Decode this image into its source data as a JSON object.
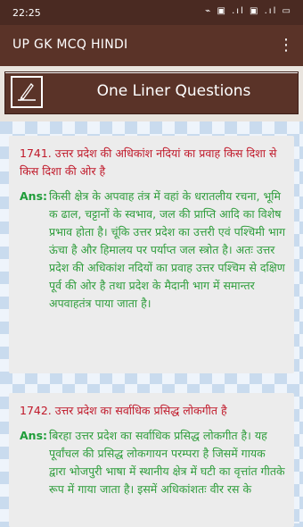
{
  "status": {
    "time": "22:25",
    "icons_text": "⌁ ▣ .ıl ▣ .ıl ▭"
  },
  "appbar": {
    "title": "UP GK MCQ HINDI",
    "menu_icon": "more-vert-icon",
    "menu_glyph": "⋮"
  },
  "banner": {
    "title": "One Liner Questions",
    "logo_icon": "pencil-note-icon"
  },
  "colors": {
    "appbar": "#5a3328",
    "question": "#c0192a",
    "answer": "#2f9d3c",
    "background": "#c9dbee"
  },
  "items": [
    {
      "question": "1741. उत्तर प्रदेश की अधिकांश नदियां का प्रवाह किस दिशा से किस दिशा की ओर है",
      "ans_label": "Ans:",
      "answer": "किसी क्षेत्र के अपवाह तंत्र में वहां के धरातलीय रचना, भूमि क ढाल, चट्टानों के स्वभाव, जल की प्राप्ति आदि का विशेष प्रभाव होता है। चूंकि उत्तर प्रदेश का उत्तरी एवं पश्चिमी भाग ऊंचा है और हिमालय पर पर्याप्त जल स्त्रोत है। अतः उत्तर प्रदेश की अधिकांश नदियों का प्रवाह उत्तर पश्चिम से दक्षिण पूर्व की ओर है तथा प्रदेश के मैदानी भाग में समान्तर अपवाहतंत्र पाया जाता है।"
    },
    {
      "question": "1742. उत्तर प्रदेश का सर्वाधिक प्रसिद्ध लोकगीत है",
      "ans_label": "Ans:",
      "answer": "बिरहा उत्तर प्रदेश का सर्वाधिक प्रसिद्ध लोकगीत है। यह पूर्वांचल की प्रसिद्ध लोकगायन परम्परा है जिसमें गायक द्वारा भोजपुरी भाषा में स्थानीय क्षेत्र में घटी का वृत्तांत गीतके रूप में गाया जाता है। इसमें अधिकांशतः वीर रस के"
    }
  ]
}
